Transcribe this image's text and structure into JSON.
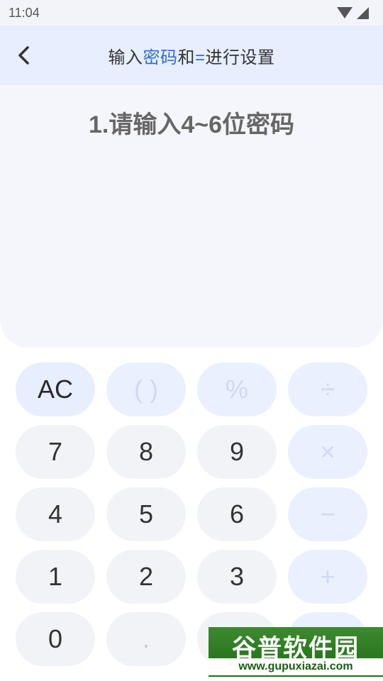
{
  "status_bar": {
    "time": "11:04"
  },
  "header": {
    "title_part1": "输入",
    "title_accent1": "密码",
    "title_part2": "和",
    "title_accent2": "=",
    "title_part3": "进行设置"
  },
  "prompt": "1.请输入4~6位密码",
  "keypad": {
    "row1": [
      "AC",
      "( )",
      "%",
      "÷"
    ],
    "row2": [
      "7",
      "8",
      "9",
      "×"
    ],
    "row3": [
      "4",
      "5",
      "6",
      "−"
    ],
    "row4": [
      "1",
      "2",
      "3",
      "+"
    ],
    "row5": [
      "0",
      ".",
      "",
      ""
    ]
  },
  "watermark": {
    "title": "谷普软件园",
    "url": "www.gupuxiazai.com"
  },
  "colors": {
    "accent": "#2f6bde",
    "header_bg": "#e7eefd",
    "key_bg": "#f2f3f7"
  }
}
